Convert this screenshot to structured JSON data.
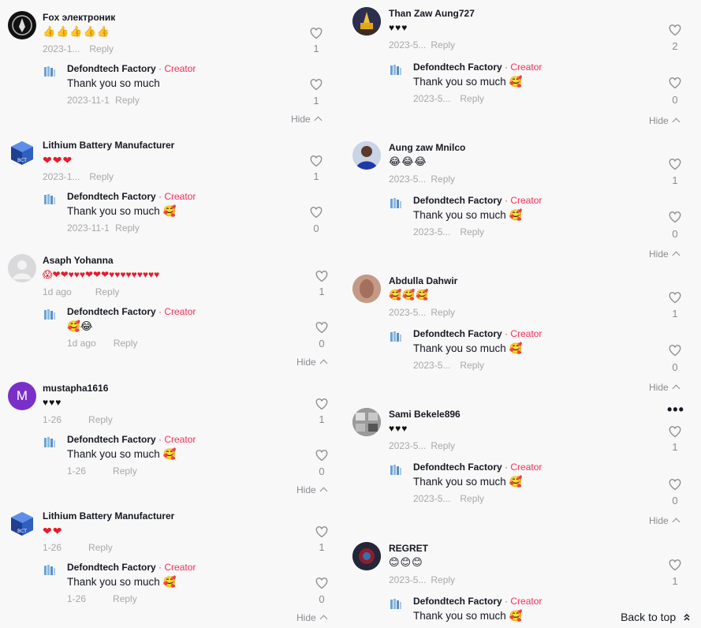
{
  "left": [
    {
      "user": "Fox электроник",
      "text": "👍👍👍👍👍",
      "date": "2023-1...",
      "reply": "Reply",
      "likes": "1",
      "r_name": "Defondtech Factory",
      "r_creator": "Creator",
      "r_sep": "·",
      "r_text": "Thank you so much",
      "r_emoji": "",
      "r_date": "2023-11-1",
      "r_reply": "Reply",
      "r_likes": "1",
      "hide": "Hide"
    },
    {
      "user": "Lithium Battery Manufacturer",
      "text": "❤❤❤",
      "date": "2023-1...",
      "reply": "Reply",
      "likes": "1",
      "r_name": "Defondtech Factory",
      "r_creator": "Creator",
      "r_sep": "·",
      "r_text": "Thank you so much",
      "r_emoji": "🥰",
      "r_date": "2023-11-1",
      "r_reply": "Reply",
      "r_likes": "0",
      "hide": ""
    },
    {
      "user": "Asaph Yohanna",
      "text": "😱❤❤♥♥♥❤❤❤♥♥♥♥♥♥♥♥♥",
      "date": "1d ago",
      "reply": "Reply",
      "likes": "1",
      "r_name": "Defondtech Factory",
      "r_creator": "Creator",
      "r_sep": "·",
      "r_text": "",
      "r_emoji": "🥰😂",
      "r_date": "1d ago",
      "r_reply": "Reply",
      "r_likes": "0",
      "hide": "Hide"
    },
    {
      "user": "mustapha1616",
      "text": "♥♥♥",
      "date": "1-26",
      "reply": "Reply",
      "likes": "1",
      "r_name": "Defondtech Factory",
      "r_creator": "Creator",
      "r_sep": "·",
      "r_text": "Thank you so much",
      "r_emoji": "🥰",
      "r_date": "1-26",
      "r_reply": "Reply",
      "r_likes": "0",
      "hide": "Hide"
    },
    {
      "user": "Lithium Battery Manufacturer",
      "text": "❤❤",
      "date": "1-26",
      "reply": "Reply",
      "likes": "1",
      "r_name": "Defondtech Factory",
      "r_creator": "Creator",
      "r_sep": "·",
      "r_text": "Thank you so much",
      "r_emoji": "🥰",
      "r_date": "1-26",
      "r_reply": "Reply",
      "r_likes": "0",
      "hide": "Hide"
    }
  ],
  "right": [
    {
      "user": "Than Zaw Aung727",
      "text": "♥♥♥",
      "date": "2023-5...",
      "reply": "Reply",
      "likes": "2",
      "r_name": "Defondtech Factory",
      "r_creator": "Creator",
      "r_sep": "·",
      "r_text": "Thank you so much",
      "r_emoji": "🥰",
      "r_date": "2023-5...",
      "r_reply": "Reply",
      "r_likes": "0",
      "hide": "Hide"
    },
    {
      "user": "Aung zaw Mnilco",
      "text": "😂😂😂",
      "date": "2023-5...",
      "reply": "Reply",
      "likes": "1",
      "r_name": "Defondtech Factory",
      "r_creator": "Creator",
      "r_sep": "·",
      "r_text": "Thank you so much",
      "r_emoji": "🥰",
      "r_date": "2023-5...",
      "r_reply": "Reply",
      "r_likes": "0",
      "hide": "Hide"
    },
    {
      "user": "Abdulla Dahwir",
      "text": "🥰🥰🥰",
      "date": "2023-5...",
      "reply": "Reply",
      "likes": "1",
      "r_name": "Defondtech Factory",
      "r_creator": "Creator",
      "r_sep": "·",
      "r_text": "Thank you so much",
      "r_emoji": "🥰",
      "r_date": "2023-5...",
      "r_reply": "Reply",
      "r_likes": "0",
      "hide": "Hide"
    },
    {
      "user": "Sami Bekele896",
      "text": "♥♥♥",
      "date": "2023-5...",
      "reply": "Reply",
      "likes": "1",
      "r_name": "Defondtech Factory",
      "r_creator": "Creator",
      "r_sep": "·",
      "r_text": "Thank you so much",
      "r_emoji": "🥰",
      "r_date": "2023-5...",
      "r_reply": "Reply",
      "r_likes": "0",
      "hide": "Hide",
      "more": "•••"
    },
    {
      "user": "REGRET",
      "text": "😊😊😊",
      "date": "2023-5...",
      "reply": "Reply",
      "likes": "1",
      "r_name": "Defondtech Factory",
      "r_creator": "Creator",
      "r_sep": "·",
      "r_text": "Thank you so much",
      "r_emoji": "🥰",
      "r_date": "",
      "r_reply": "",
      "r_likes": "",
      "hide": ""
    }
  ],
  "back_to_top": "Back to top",
  "colors": {
    "creator": "#fe2c55",
    "muted": "#a7a8ab",
    "text": "#161823",
    "heart": "#e8192c"
  }
}
